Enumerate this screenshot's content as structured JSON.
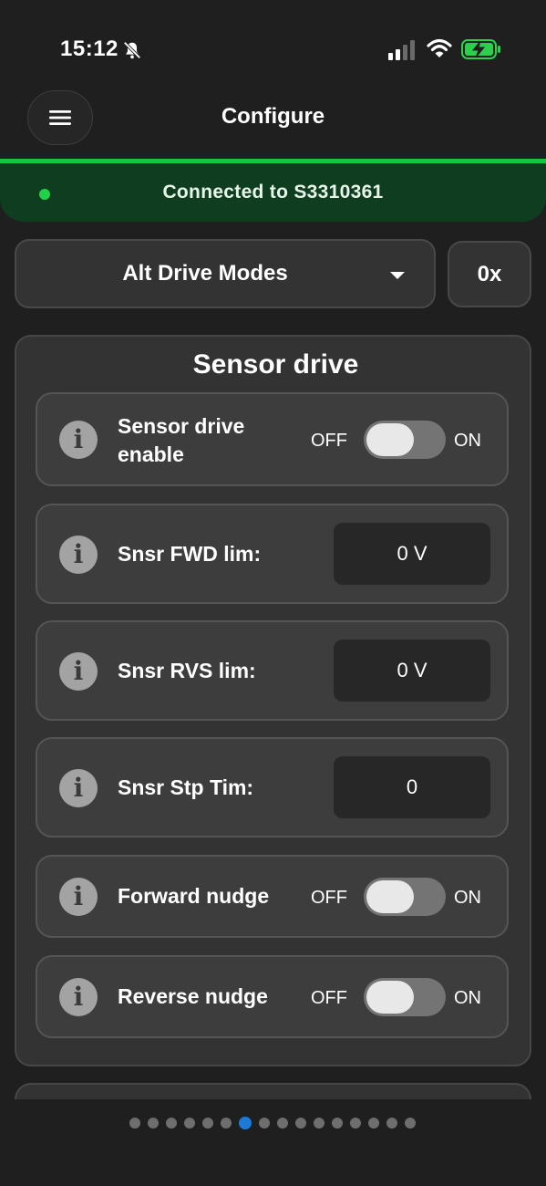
{
  "status_bar": {
    "time": "15:12"
  },
  "header": {
    "title": "Configure"
  },
  "connection": {
    "text": "Connected to S3310361"
  },
  "mode_select": {
    "value": "Alt Drive Modes"
  },
  "hex_button": {
    "label": "0x"
  },
  "section": {
    "title": "Sensor drive",
    "toggles": [
      {
        "label": "Sensor drive enable",
        "off": "OFF",
        "on": "ON",
        "state": "off"
      },
      {
        "label": "Forward nudge",
        "off": "OFF",
        "on": "ON",
        "state": "off"
      },
      {
        "label": "Reverse nudge",
        "off": "OFF",
        "on": "ON",
        "state": "off"
      }
    ],
    "fields": [
      {
        "label": "Snsr FWD lim:",
        "value": "0 V"
      },
      {
        "label": "Snsr RVS lim:",
        "value": "0 V"
      },
      {
        "label": "Snsr Stp Tim:",
        "value": "0"
      }
    ]
  },
  "pager": {
    "total": 16,
    "active": 7
  },
  "colors": {
    "connected": "#19c43f",
    "banner_bg": "#0f3d1f",
    "pager_active": "#1c7ad8"
  },
  "icons": [
    "bell-slash-icon",
    "signal-icon",
    "wifi-icon",
    "battery-charging-icon",
    "menu-icon",
    "info-icon",
    "chevron-down-icon"
  ]
}
